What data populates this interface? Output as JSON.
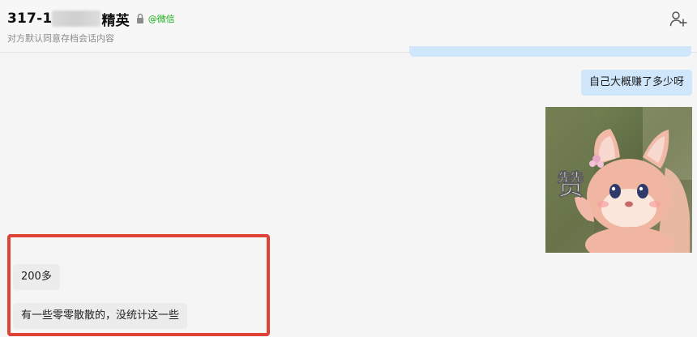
{
  "header": {
    "title_prefix": "317-1",
    "title_suffix": "精英",
    "wechat_tag": "@微信",
    "subtitle": "对方默认同意存档会话内容"
  },
  "icons": {
    "lock": "lock-icon",
    "add_member": "add-member-icon"
  },
  "messages": [
    {
      "side": "right",
      "type": "text",
      "text": "自己大概赚了多少呀"
    },
    {
      "side": "right",
      "type": "sticker",
      "caption": "赞"
    },
    {
      "side": "left",
      "type": "text",
      "text": "200多"
    },
    {
      "side": "left",
      "type": "text",
      "text": "有一些零零散散的，没统计这一些"
    }
  ],
  "colors": {
    "self_bubble": "#cfe6fb",
    "other_bubble": "#ececec",
    "highlight": "#e04336",
    "wechat_green": "#1aad19"
  }
}
